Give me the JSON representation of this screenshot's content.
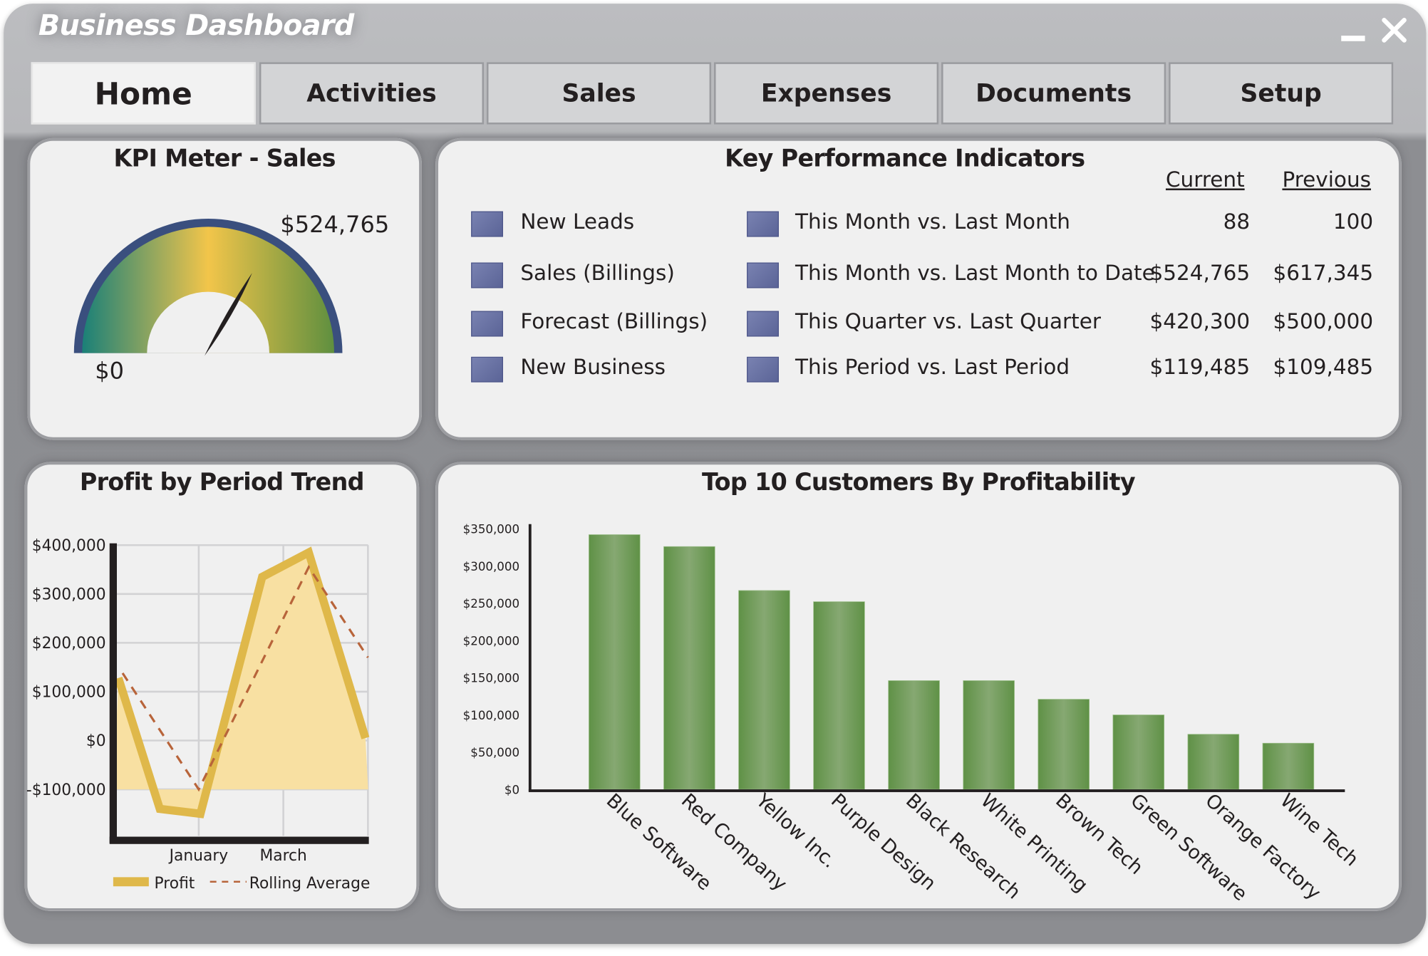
{
  "window": {
    "title": "Business Dashboard",
    "minimize_icon": "minimize-icon",
    "close_icon": "close-icon"
  },
  "tabs": [
    {
      "label": "Home",
      "active": true
    },
    {
      "label": "Activities",
      "active": false
    },
    {
      "label": "Sales",
      "active": false
    },
    {
      "label": "Expenses",
      "active": false
    },
    {
      "label": "Documents",
      "active": false
    },
    {
      "label": "Setup",
      "active": false
    }
  ],
  "kpi_meter": {
    "title": "KPI Meter - Sales",
    "value_label": "$524,765",
    "min_label": "$0",
    "needle_fraction": 0.66,
    "colors": {
      "rim": "#3a4f7e",
      "low": "#1a8078",
      "mid": "#f2c54a",
      "high": "#5f8f3f",
      "needle": "#231f20"
    }
  },
  "kpi_table": {
    "title": "Key Performance Indicators",
    "headers": {
      "current": "Current",
      "previous": "Previous"
    },
    "marker_color": "#6670a0",
    "rows": [
      {
        "metric": "New Leads",
        "period": "This Month vs. Last Month",
        "current": "88",
        "previous": "100"
      },
      {
        "metric": "Sales (Billings)",
        "period": "This Month vs. Last Month to Date",
        "current": "$524,765",
        "previous": "$617,345"
      },
      {
        "metric": "Forecast (Billings)",
        "period": "This Quarter vs. Last Quarter",
        "current": "$420,300",
        "previous": "$500,000"
      },
      {
        "metric": "New Business",
        "period": "This Period vs. Last Period",
        "current": "$119,485",
        "previous": "$109,485"
      }
    ]
  },
  "chart_data": [
    {
      "type": "line",
      "title": "Profit by Period Trend",
      "xlabel": "",
      "ylabel": "",
      "x_ticks": [
        {
          "x": 1,
          "label": "January"
        },
        {
          "x": 2,
          "label": "March"
        }
      ],
      "xlim": [
        0,
        3
      ],
      "ylim": [
        -195000,
        400000
      ],
      "y_ticks": [
        400000,
        300000,
        200000,
        100000,
        0,
        -100000
      ],
      "y_tick_labels": [
        "$400,000",
        "$300,000",
        "$200,000",
        "$100,000",
        "$0",
        "-$100,000"
      ],
      "grid": true,
      "legend": "bottom",
      "series": [
        {
          "name": "Profit",
          "style": "solid-area",
          "color": "#dfb84a",
          "fill": "#f8e0a2",
          "points": [
            [
              0.05,
              128000
            ],
            [
              0.54,
              -140000
            ],
            [
              1.02,
              -150000
            ],
            [
              1.75,
              335000
            ],
            [
              2.3,
              385000
            ],
            [
              2.97,
              5000
            ]
          ]
        },
        {
          "name": "Rolling Average",
          "style": "dashed",
          "color": "#b8643a",
          "points": [
            [
              0.1,
              138000
            ],
            [
              1.0,
              -100000
            ],
            [
              2.3,
              355000
            ],
            [
              3.0,
              170000
            ]
          ]
        }
      ]
    },
    {
      "type": "bar",
      "title": "Top 10 Customers By Profitability",
      "xlabel": "",
      "ylabel": "",
      "categories": [
        "Blue Software",
        "Red Company",
        "Yellow Inc.",
        "Purple Design",
        "Black Research",
        "White Printing",
        "Brown Tech",
        "Green Software",
        "Orange Factory",
        "Wine Tech"
      ],
      "values": [
        342000,
        326000,
        267000,
        252000,
        146000,
        146000,
        121000,
        100000,
        74000,
        62000
      ],
      "ylim": [
        0,
        350000
      ],
      "y_ticks": [
        350000,
        300000,
        250000,
        200000,
        150000,
        100000,
        50000,
        0
      ],
      "y_tick_labels": [
        "$350,000",
        "$300,000",
        "$250,000",
        "$200,000",
        "$150,000",
        "$100,000",
        "$50,000",
        "$0"
      ],
      "grid": false,
      "bar_color": "#6a9a50"
    }
  ]
}
